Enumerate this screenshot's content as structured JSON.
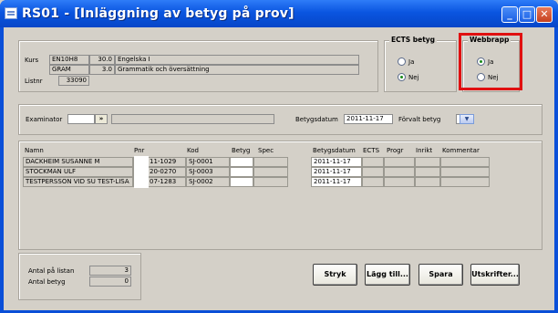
{
  "window": {
    "title": "RS01 - [Inläggning av betyg på prov]",
    "min": "_",
    "max": "□",
    "close": "✕"
  },
  "course": {
    "kurs_label": "Kurs",
    "listnr_label": "Listnr",
    "rows": [
      {
        "code": "EN10H8",
        "points": "30.0",
        "name": "Engelska I"
      },
      {
        "code": "GRAM",
        "points": "3.0",
        "name": "Grammatik och översättning"
      }
    ],
    "listnr": "33090"
  },
  "ects": {
    "title": "ECTS betyg",
    "ja": "Ja",
    "nej": "Nej",
    "selected": "Nej"
  },
  "webbrapp": {
    "title": "Webbrapp",
    "ja": "Ja",
    "nej": "Nej",
    "selected": "Ja"
  },
  "examinator": {
    "label": "Examinator",
    "button": "»",
    "value": "",
    "name": ""
  },
  "betygsdatum": {
    "label": "Betygsdatum",
    "value": "2011-11-17"
  },
  "forvalt": {
    "label": "Förvalt betyg",
    "value": ""
  },
  "table": {
    "headers": {
      "namn": "Namn",
      "pnr": "Pnr",
      "kod": "Kod",
      "betyg": "Betyg",
      "spec": "Spec",
      "betygsdatum": "Betygsdatum",
      "ects": "ECTS",
      "progr": "Progr",
      "inrikt": "Inrikt",
      "kommentar": "Kommentar"
    },
    "rows": [
      {
        "namn": "DACKHEIM SUSANNE M",
        "pnr": "11-1029",
        "kod": "SJ-0001",
        "datum": "2011-11-17"
      },
      {
        "namn": "STOCKMAN ULF",
        "pnr": "20-0270",
        "kod": "SJ-0003",
        "datum": "2011-11-17"
      },
      {
        "namn": "TESTPERSSON VID SU TEST-LISA",
        "pnr": "07-1283",
        "kod": "SJ-0002",
        "datum": "2011-11-17"
      }
    ]
  },
  "stats": {
    "listan_label": "Antal på listan",
    "listan": "3",
    "betyg_label": "Antal betyg",
    "betyg": "0"
  },
  "buttons": {
    "stryk": "Stryk",
    "lagg": "Lägg till...",
    "spara": "Spara",
    "utskrifter": "Utskrifter..."
  }
}
